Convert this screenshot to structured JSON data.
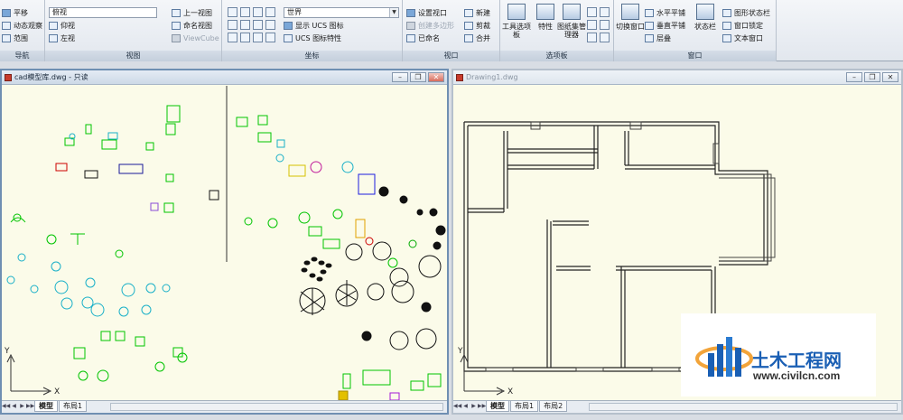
{
  "ribbon": {
    "panels": [
      {
        "name": "nav",
        "title": "导航",
        "items": [
          "平移",
          "动态观察",
          "范围"
        ]
      },
      {
        "name": "views",
        "title": "视图",
        "items": [
          "俯视",
          "仰视",
          "左视",
          "上一视图",
          "命名视图",
          "ViewCube"
        ]
      },
      {
        "name": "coords",
        "title": "坐标",
        "combo": "世界",
        "items": [
          "显示 UCS 图标",
          "UCS 图标特性"
        ]
      },
      {
        "name": "viewport",
        "title": "视口",
        "items": [
          "设置视口",
          "创建多边形",
          "已命名",
          "新建",
          "剪裁",
          "合并"
        ]
      },
      {
        "name": "palettes",
        "title": "选项板",
        "big": [
          "工具选项板",
          "特性",
          "图纸集管理器"
        ]
      },
      {
        "name": "window",
        "title": "窗口",
        "big": [
          "切换窗口",
          "状态栏"
        ],
        "items": [
          "水平平铺",
          "垂直平铺",
          "层叠",
          "图形状态栏",
          "窗口锁定",
          "文本窗口"
        ]
      }
    ]
  },
  "windows": [
    {
      "title": "cad模型库.dwg - 只读",
      "tabs": [
        "模型",
        "布局1"
      ],
      "active": true
    },
    {
      "title": "Drawing1.dwg",
      "tabs": [
        "模型",
        "布局1",
        "布局2"
      ],
      "active": false
    }
  ],
  "axis": {
    "x": "X",
    "y": "Y"
  },
  "watermark": {
    "brand": "土木工程网",
    "url": "www.civilcn.com"
  },
  "colors": {
    "canvas": "#fbfbe9",
    "accent": "#00c400",
    "wall": "#222222",
    "watermark_blue": "#1a5fb4"
  }
}
